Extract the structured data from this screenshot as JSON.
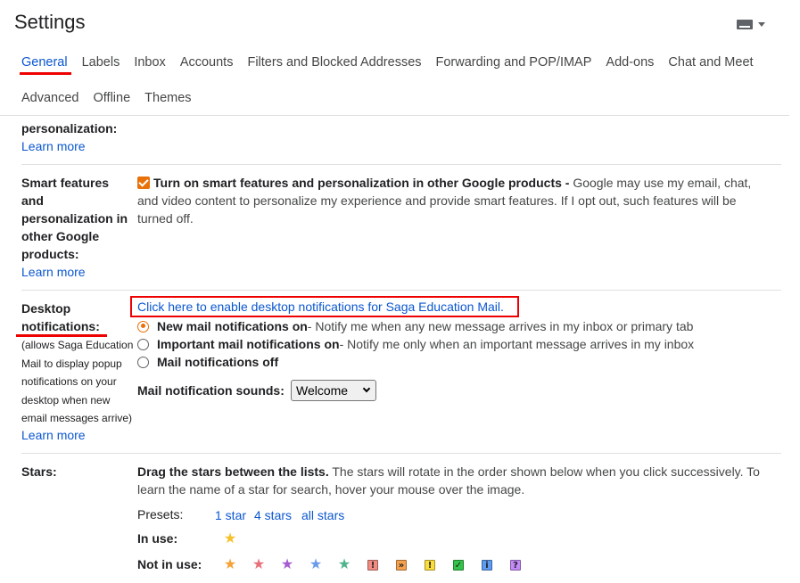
{
  "header": {
    "title": "Settings",
    "keyboard_icon": "keyboard-icon"
  },
  "tabs_row1": [
    "General",
    "Labels",
    "Inbox",
    "Accounts",
    "Filters and Blocked Addresses",
    "Forwarding and POP/IMAP",
    "Add-ons",
    "Chat and Meet"
  ],
  "tabs_row2": [
    "Advanced",
    "Offline",
    "Themes"
  ],
  "active_tab": "General",
  "partial_section": {
    "label": "personalization:",
    "learn_more": "Learn more"
  },
  "smart_features": {
    "label_lines": [
      "Smart features",
      "and",
      "personalization in",
      "other Google",
      "products:"
    ],
    "learn_more": "Learn more",
    "checkbox_checked": true,
    "bold_text": "Turn on smart features and personalization in other Google products -",
    "desc_line1": " Google may use my email, chat,",
    "desc_line2": "and video content to personalize my experience and provide smart features. If I opt out, such features will be",
    "desc_line3": "turned off."
  },
  "desktop_notifications": {
    "label_lines": [
      "Desktop",
      "notifications:"
    ],
    "note_lines": [
      "(allows Saga Education",
      "Mail to display popup",
      "notifications on your",
      "desktop when new",
      "email messages arrive)"
    ],
    "learn_more": "Learn more",
    "enable_link": "Click here to enable desktop notifications for Saga Education Mail.",
    "options": [
      {
        "title": "New mail notifications on",
        "desc": " - Notify me when any new message arrives in my inbox or primary tab",
        "selected": true
      },
      {
        "title": "Important mail notifications on",
        "desc": " - Notify me only when an important message arrives in my inbox",
        "selected": false
      },
      {
        "title": "Mail notifications off",
        "desc": "",
        "selected": false
      }
    ],
    "sound_label": "Mail notification sounds:",
    "sound_value": "Welcome"
  },
  "stars": {
    "label": "Stars:",
    "bold_text": "Drag the stars between the lists.",
    "desc_line1": "  The stars will rotate in the order shown below when you click successively. To",
    "desc_line2": "learn the name of a star for search, hover your mouse over the image.",
    "presets_label": "Presets:",
    "presets": [
      "1 star",
      "4 stars",
      "all stars"
    ],
    "in_use_label": "In use:",
    "not_in_use_label": "Not in use:",
    "in_use": [
      {
        "name": "yellow-star-icon",
        "color": "#f6c026"
      }
    ],
    "not_in_use": [
      {
        "name": "orange-star-icon",
        "kind": "star",
        "color": "#f4a236"
      },
      {
        "name": "red-star-icon",
        "kind": "star",
        "color": "#e8707a"
      },
      {
        "name": "purple-star-icon",
        "kind": "star",
        "color": "#a55ed1"
      },
      {
        "name": "blue-star-icon",
        "kind": "star",
        "color": "#6a9be9"
      },
      {
        "name": "green-star-icon",
        "kind": "star",
        "color": "#4fb38b"
      },
      {
        "name": "red-bang-icon",
        "kind": "box",
        "color": "#f28b82",
        "glyph": "!"
      },
      {
        "name": "orange-guillemet-icon",
        "kind": "box",
        "color": "#f6a14d",
        "glyph": "»"
      },
      {
        "name": "yellow-bang-icon",
        "kind": "box",
        "color": "#fbdd3a",
        "glyph": "!"
      },
      {
        "name": "green-check-icon",
        "kind": "box",
        "color": "#34c24a",
        "glyph": "✓"
      },
      {
        "name": "blue-info-icon",
        "kind": "box",
        "color": "#5d9cf0",
        "glyph": "i"
      },
      {
        "name": "purple-question-icon",
        "kind": "box",
        "color": "#c58af9",
        "glyph": "?"
      }
    ]
  }
}
